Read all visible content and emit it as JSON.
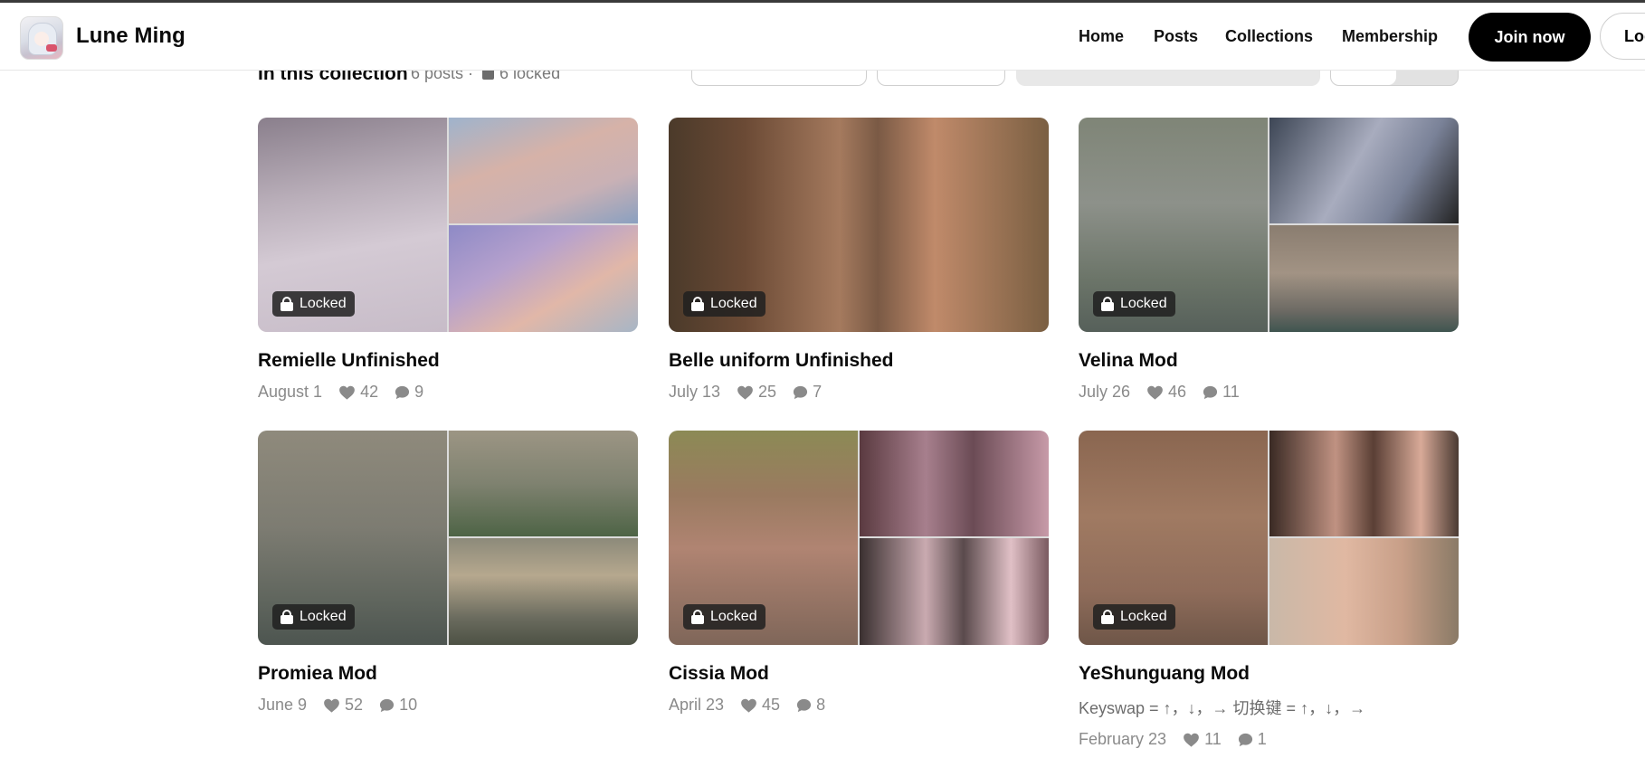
{
  "header": {
    "creator_name": "Lune Ming",
    "nav": [
      "Home",
      "Posts",
      "Collections",
      "Membership"
    ],
    "join_label": "Join now",
    "login_label": "Log in"
  },
  "collection": {
    "title": "In this collection",
    "post_count": "6 posts ·",
    "locked_count": "6 locked"
  },
  "colors": {
    "accent": "#000000",
    "badge_bg": "#202020",
    "meta_text": "#8a8a8a"
  },
  "posts": [
    {
      "title": "Remielle Unfinished",
      "description": "",
      "date": "August 1",
      "likes": "42",
      "comments": "9",
      "locked_label": "Locked",
      "tiles": [
        "linear-gradient(170deg,#8a7f8c 0%,#b9aeb9 35%,#d4cad4 60%,#c7bcc8 100%)",
        "linear-gradient(160deg,#9fb3cc 0%,#d6b2a8 40%,#c9b1b5 70%,#8aa0c0 100%)",
        "linear-gradient(150deg,#8e8ac6 0%,#b6a1cd 35%,#e1b7a8 65%,#a7b6c6 100%)"
      ]
    },
    {
      "title": "Belle uniform Unfinished",
      "description": "",
      "date": "July 13",
      "likes": "25",
      "comments": "7",
      "locked_label": "Locked",
      "tiles": [
        "linear-gradient(90deg,#4b3a2a 0%,#6b4a35 20%,#a57a5e 45%,#7a5a45 55%,#c08a6a 70%,#7a5f42 100%)"
      ]
    },
    {
      "title": "Velina Mod",
      "description": "",
      "date": "July 26",
      "likes": "46",
      "comments": "11",
      "locked_label": "Locked",
      "tiles": [
        "linear-gradient(180deg,#7f8577 0%,#8d918a 40%,#6c7569 75%,#56605a 100%)",
        "linear-gradient(120deg,#3d4655 0%,#a8acbe 45%,#7a8298 70%,#222 100%)",
        "linear-gradient(180deg,#8a7d70 0%,#a29384 45%,#6d6a64 80%,#3f5550 100%)"
      ]
    },
    {
      "title": "Promiea Mod",
      "description": "",
      "date": "June 9",
      "likes": "52",
      "comments": "10",
      "locked_label": "Locked",
      "tiles": [
        "linear-gradient(180deg,#8f8a7c 0%,#7d7c72 45%,#5f655d 80%,#4d5550 100%)",
        "linear-gradient(180deg,#9c9584 0%,#7f8270 50%,#4e6446 100%)",
        "linear-gradient(180deg,#8c8a7a 0%,#b6a88e 35%,#6a6b5e 75%,#4d5144 100%)"
      ]
    },
    {
      "title": "Cissia Mod",
      "description": "",
      "date": "April 23",
      "likes": "45",
      "comments": "8",
      "locked_label": "Locked",
      "tiles": [
        "linear-gradient(180deg,#8c8a55 0%,#9a7a60 30%,#b08472 55%,#7f6659 100%)",
        "linear-gradient(90deg,#5a3a40 0%,#a77f8d 35%,#6b4b55 60%,#c79aa8 100%)",
        "linear-gradient(90deg,#3a3030 0%,#c9aab0 35%,#5a4a4c 55%,#e0c0c6 80%,#7a5a60 100%)"
      ]
    },
    {
      "title": "YeShunguang Mod",
      "description": "Keyswap = ↑，↓，→ 切换键 = ↑，↓，→",
      "date": "February 23",
      "likes": "11",
      "comments": "1",
      "locked_label": "Locked",
      "tiles": [
        "linear-gradient(180deg,#8a6650 0%,#a07a62 40%,#8f6c5a 75%,#6e5648 100%)",
        "linear-gradient(90deg,#3a2a24 0%,#c09282 35%,#5a3f35 55%,#d8aa98 80%,#4a3a32 100%)",
        "linear-gradient(90deg,#c9b8a8 0%,#e0b8a2 40%,#c89f88 70%,#8a7a66 100%)"
      ]
    }
  ]
}
